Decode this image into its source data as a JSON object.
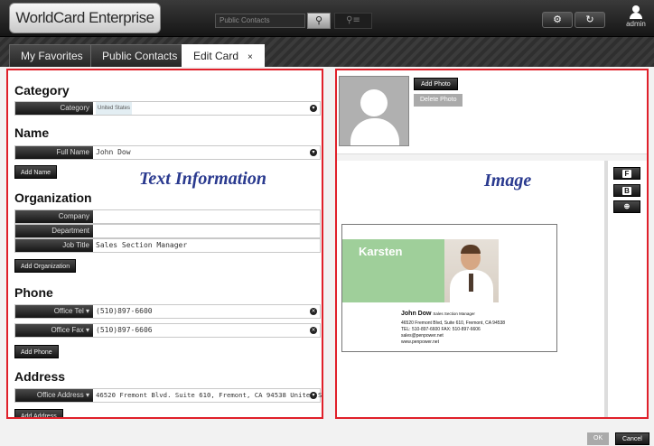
{
  "app": {
    "logo_text": "WorldCard Enterprise",
    "search_placeholder": "Public Contacts",
    "user": "admin"
  },
  "icons": {
    "search": "search-icon",
    "advanced_search": "advanced-search-icon",
    "settings": "gear-icon",
    "sync": "sync-icon",
    "user": "user-icon",
    "close_tab": "close-icon",
    "photo_placeholder": "person-silhouette-icon",
    "rotate": "rotate-icon",
    "zoom": "zoom-in-icon"
  },
  "tabs": [
    {
      "label": "My Favorites"
    },
    {
      "label": "Public Contacts"
    },
    {
      "label": "Edit Card",
      "close": "×"
    }
  ],
  "left": {
    "overlay_title": "Text Information",
    "category": {
      "title": "Category",
      "label": "Category",
      "value": "United States"
    },
    "name": {
      "title": "Name",
      "label": "Full Name",
      "value": "John Dow",
      "add_button": "Add Name"
    },
    "organization": {
      "title": "Organization",
      "fields": [
        {
          "label": "Company",
          "value": ""
        },
        {
          "label": "Department",
          "value": ""
        },
        {
          "label": "Job Title",
          "value": "Sales Section Manager"
        }
      ],
      "add_button": "Add Organization"
    },
    "phone": {
      "title": "Phone",
      "fields": [
        {
          "label": "Office Tel",
          "value": "(510)897-6600"
        },
        {
          "label": "Office Fax",
          "value": "(510)897-6606"
        }
      ],
      "add_button": "Add Phone"
    },
    "address": {
      "title": "Address",
      "fields": [
        {
          "label": "Office Address",
          "value": "46520 Fremont Blvd. Suite 610, Fremont, CA 94538 United S"
        }
      ],
      "add_button": "Add Address"
    }
  },
  "right": {
    "overlay_title": "Image",
    "add_photo": "Add Photo",
    "delete_photo": "Delete Photo",
    "tools": [
      {
        "letter": "F"
      },
      {
        "letter": "B"
      }
    ],
    "card": {
      "first_name": "Karsten",
      "name": "John Dow",
      "title": "Sales Section Manager",
      "address": "46520 Fremont Blvd, Suite 610, Fremont, CA 94538",
      "tel_fax": "TEL: 510-897-6600    FAX: 510-897-6606",
      "email": "sales@penpower.net",
      "web": "www.penpower.net"
    }
  },
  "footer": {
    "ok": "OK",
    "cancel": "Cancel"
  },
  "colors": {
    "annotation_border": "#e0202a",
    "annotation_text": "#2a3a8f"
  }
}
